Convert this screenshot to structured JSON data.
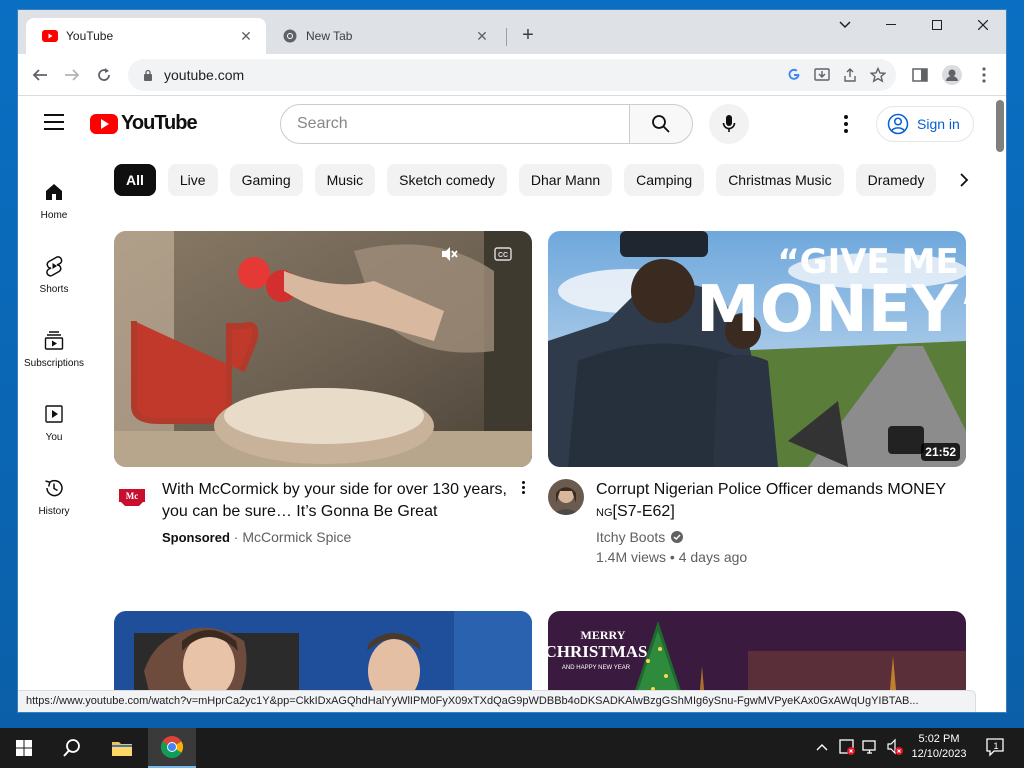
{
  "browser": {
    "tabs": [
      {
        "label": "YouTube",
        "active": true
      },
      {
        "label": "New Tab",
        "active": false
      }
    ],
    "url": "youtube.com",
    "status_url": "https://www.youtube.com/watch?v=mHprCa2yc1Y&pp=CkkIDxAGQhdHalYyWlIPM0FyX09xTXdQaG9pWDBBb4oDKSADKAlwBzgGShMIg6ySnu-FgwMVPyeKAx0GxAWqUgYIBTAB..."
  },
  "youtube": {
    "logo_text": "YouTube",
    "search_placeholder": "Search",
    "signin_label": "Sign in",
    "guide": [
      {
        "label": "Home",
        "icon": "home-icon"
      },
      {
        "label": "Shorts",
        "icon": "shorts-icon"
      },
      {
        "label": "Subscriptions",
        "icon": "subscriptions-icon"
      },
      {
        "label": "You",
        "icon": "you-icon"
      },
      {
        "label": "History",
        "icon": "history-icon"
      }
    ],
    "chips": [
      "All",
      "Live",
      "Gaming",
      "Music",
      "Sketch comedy",
      "Dhar Mann",
      "Camping",
      "Christmas Music",
      "Dramedy"
    ],
    "videos": [
      {
        "title": "With McCormick by your side for over 130 years, you can be sure… It’s Gonna Be Great",
        "sponsored": "Sponsored",
        "separator": " · ",
        "channel": "McCormick Spice"
      },
      {
        "title_main": "Corrupt Nigerian Police Officer demands MONEY ",
        "title_small": "NG",
        "title_tail": "[S7-E62]",
        "channel": "Itchy Boots",
        "stats": "1.4M views • 4 days ago",
        "duration": "21:52",
        "thumb_text_1": "“GIVE ME",
        "thumb_text_2": "MONEY”"
      },
      {
        "thumb": "talk-show"
      },
      {
        "thumb": "christmas",
        "thumb_text_1": "MERRY",
        "thumb_text_2": "CHRISTMAS",
        "thumb_text_3": "AND HAPPY NEW YEAR"
      }
    ]
  },
  "taskbar": {
    "time": "5:02 PM",
    "date": "12/10/2023",
    "notifications": "1"
  },
  "colors": {
    "youtube_red": "#ff0000",
    "link_blue": "#065fd4",
    "taskbar": "#1b1b1b"
  }
}
